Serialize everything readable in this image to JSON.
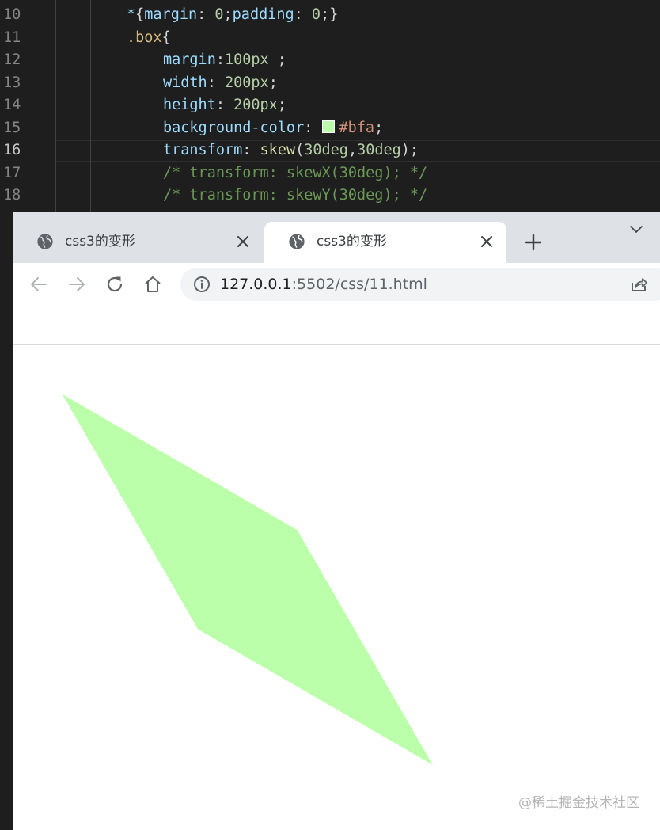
{
  "editor": {
    "line_numbers": [
      "10",
      "11",
      "12",
      "13",
      "14",
      "15",
      "16",
      "17",
      "18"
    ],
    "active_line": "16",
    "code": {
      "l10": {
        "star": "*",
        "open": "{",
        "p1": "margin",
        "sep1": ": ",
        "v1": "0",
        "semi1": ";",
        "p2": "padding",
        "sep2": ": ",
        "v2": "0",
        "close": ";}"
      },
      "l11": {
        "selector": ".box",
        "open": "{"
      },
      "l12": {
        "prop": "margin",
        "sep": ":",
        "value": "100px",
        "end": " ;"
      },
      "l13": {
        "prop": "width",
        "sep": ": ",
        "value": "200px",
        "end": ";"
      },
      "l14": {
        "prop": "height",
        "sep": ": ",
        "value": "200px",
        "end": ";"
      },
      "l15": {
        "prop": "background-color",
        "sep": ": ",
        "value": "#bfa",
        "end": ";"
      },
      "l16": {
        "prop": "transform",
        "sep": ": ",
        "fn": "skew",
        "open": "(",
        "a1": "30deg",
        "comma": ",",
        "a2": "30deg",
        "end": ");"
      },
      "l17": {
        "comment": "/* transform: skewX(30deg); */"
      },
      "l18": {
        "comment": "/* transform: skewY(30deg); */"
      }
    }
  },
  "browser": {
    "tabs": [
      {
        "title": "css3的变形",
        "icon": "globe-icon",
        "active": false
      },
      {
        "title": "css3的变形",
        "icon": "globe-icon",
        "active": true
      }
    ],
    "url": {
      "host": "127.0.0.1",
      "path": ":5502/css/11.html"
    }
  },
  "page": {
    "box": {
      "background": "#bbffaa",
      "width": 200,
      "height": 200,
      "margin": 100,
      "skew_x_deg": 30,
      "skew_y_deg": 30
    }
  },
  "watermark": "@稀土掘金技术社区",
  "colors": {
    "editor_bg": "#1e1e1e",
    "tab_strip": "#dee1e6",
    "box_fill": "#bbffaa"
  }
}
